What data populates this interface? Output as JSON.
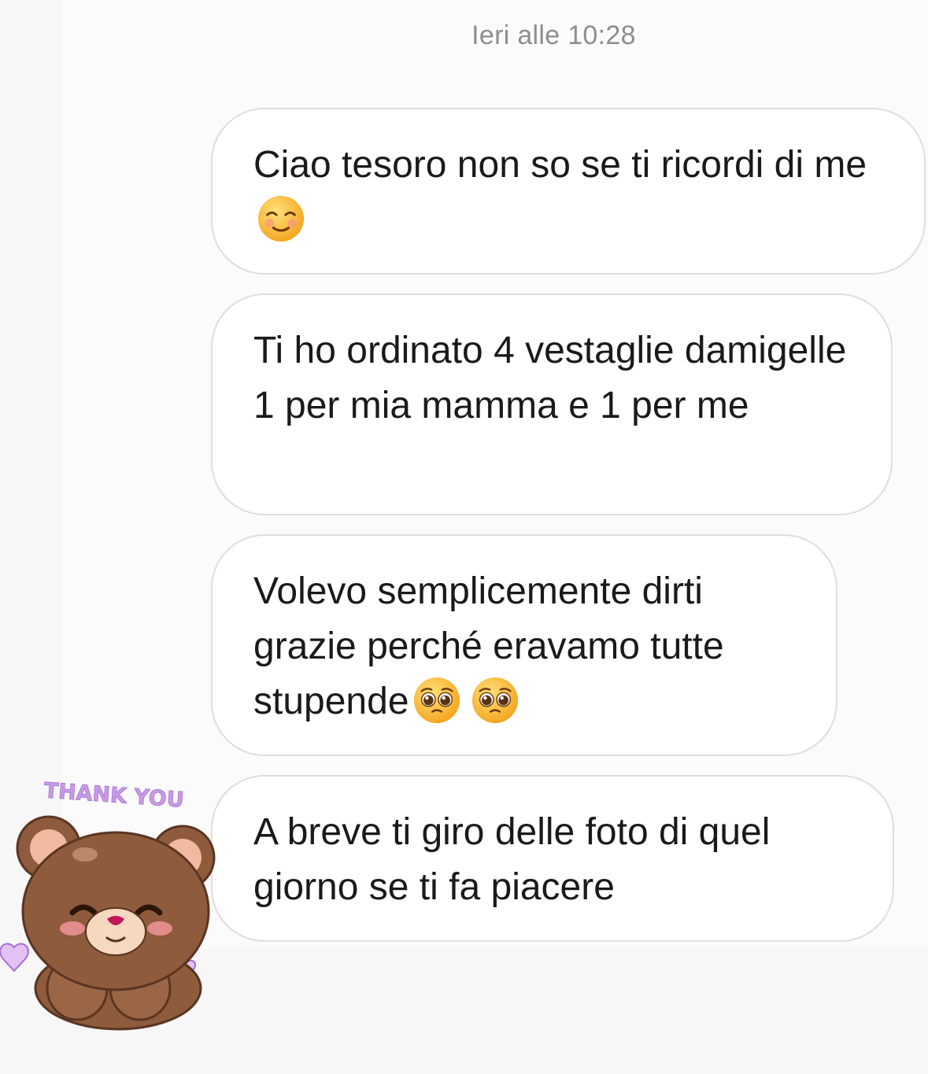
{
  "thread": {
    "timestamp": "Ieri alle 10:28",
    "messages": [
      {
        "text": "Ciao tesoro non so se ti ricordi di me",
        "emojis": [
          "smiling-face-icon"
        ]
      },
      {
        "text": "Ti ho ordinato 4 vestaglie damigelle 1 per mia mamma e 1 per me",
        "emojis": []
      },
      {
        "text": "Volevo semplicemente dirti grazie perché eravamo tutte stupende",
        "emojis": [
          "pleading-face-icon",
          "pleading-face-icon"
        ]
      },
      {
        "text": "A breve ti giro delle foto di quel giorno se ti fa piacere",
        "emojis": []
      }
    ],
    "sticker": {
      "caption": "THANK YOU",
      "icon": "teddy-bear-thank-you-icon"
    }
  },
  "colors": {
    "bubble_border": "#dedede",
    "bubble_bg": "#ffffff",
    "text": "#1a1a1a",
    "timestamp": "#8e8e8e",
    "sticker_caption": "#c79be6",
    "bear": "#8e5b3c"
  }
}
